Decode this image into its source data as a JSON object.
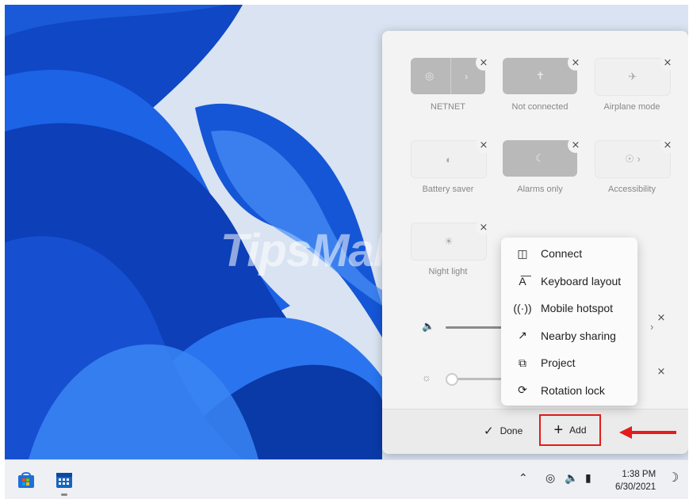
{
  "quick_settings": {
    "tiles": [
      {
        "label": "NETNET",
        "icon": "wifi-icon",
        "state": "on"
      },
      {
        "label": "Not connected",
        "icon": "bluetooth-icon",
        "state": "on"
      },
      {
        "label": "Airplane mode",
        "icon": "airplane-icon",
        "state": "off"
      },
      {
        "label": "Battery saver",
        "icon": "battery-saver-icon",
        "state": "off"
      },
      {
        "label": "Alarms only",
        "icon": "moon-icon",
        "state": "on"
      },
      {
        "label": "Accessibility",
        "icon": "accessibility-icon",
        "state": "off"
      },
      {
        "label": "Night light",
        "icon": "night-light-icon",
        "state": "off"
      }
    ],
    "sliders": [
      {
        "name": "volume",
        "icon": "speaker-icon",
        "level": 0.5
      },
      {
        "name": "brightness",
        "icon": "sun-icon",
        "level": 0.05
      }
    ],
    "footer": {
      "done_label": "Done",
      "add_label": "Add"
    }
  },
  "add_menu": {
    "items": [
      {
        "label": "Connect",
        "icon": "cast-icon"
      },
      {
        "label": "Keyboard layout",
        "icon": "keyboard-layout-icon"
      },
      {
        "label": "Mobile hotspot",
        "icon": "hotspot-icon"
      },
      {
        "label": "Nearby sharing",
        "icon": "nearby-sharing-icon"
      },
      {
        "label": "Project",
        "icon": "project-icon"
      },
      {
        "label": "Rotation lock",
        "icon": "rotation-lock-icon"
      }
    ]
  },
  "watermark": "TipsMake",
  "taskbar": {
    "clock_time": "1:38 PM",
    "clock_date": "6/30/2021"
  },
  "colors": {
    "highlight": "#e21c1c",
    "accent": "#0a4fd6"
  }
}
